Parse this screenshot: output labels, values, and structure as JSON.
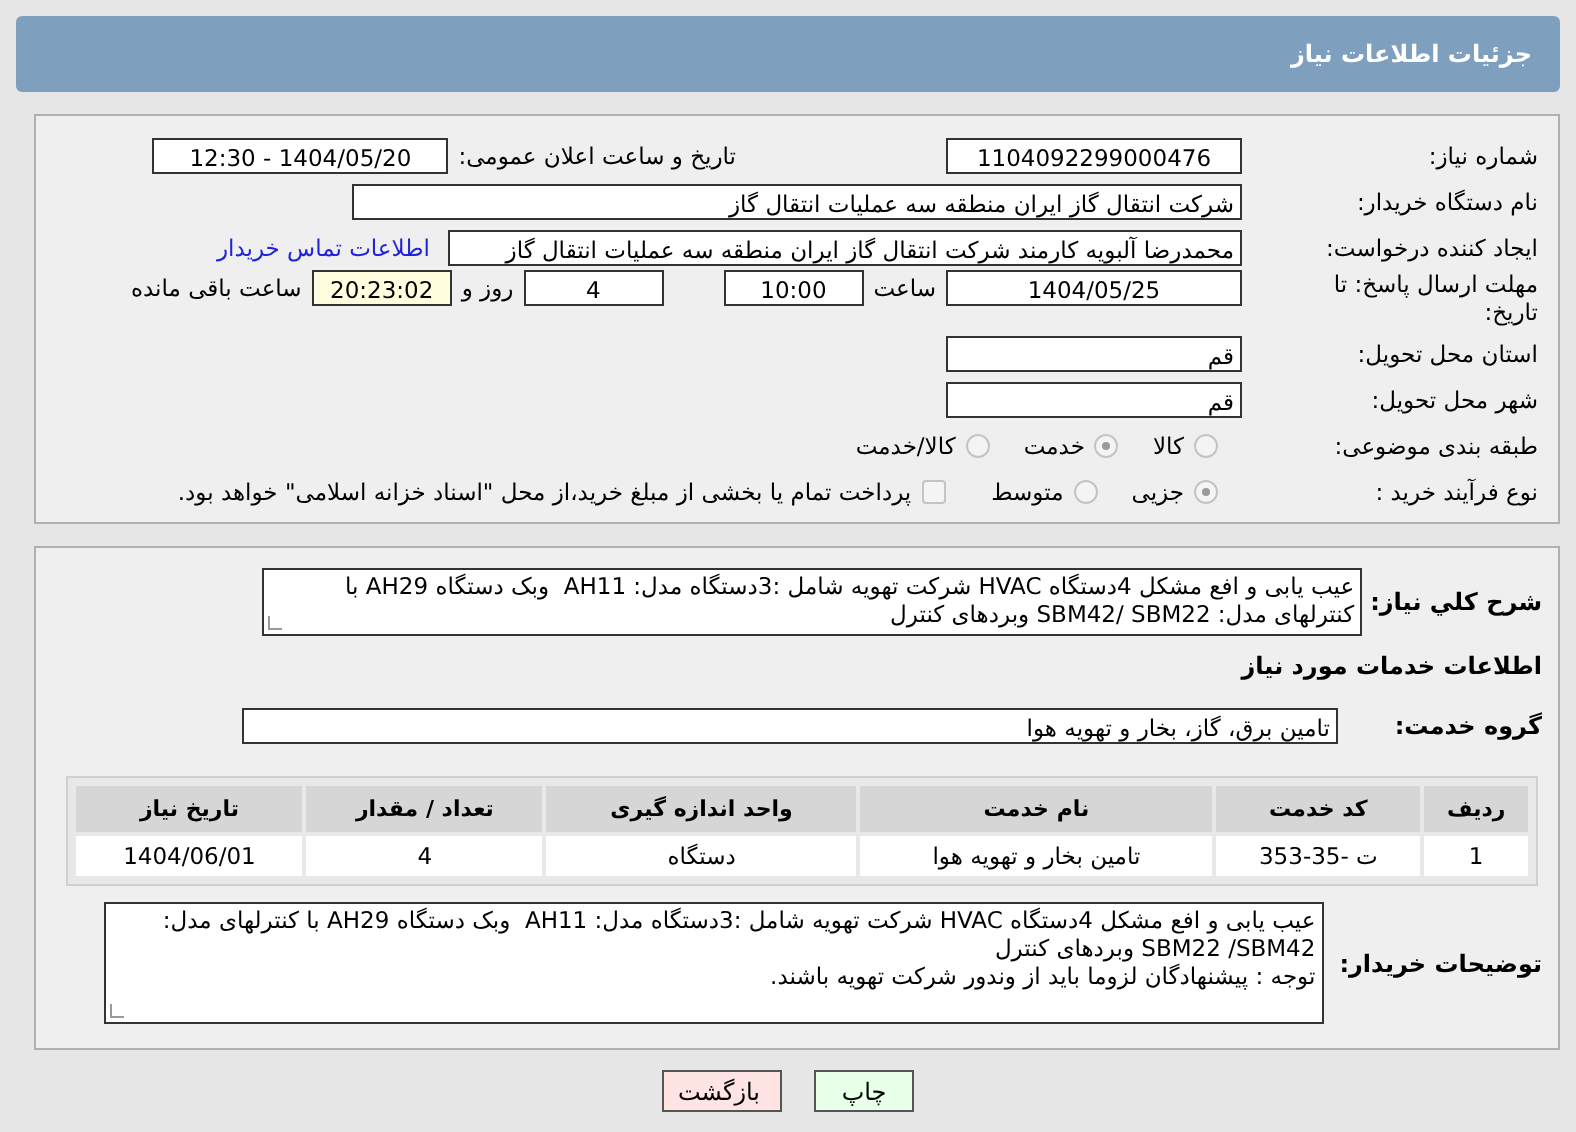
{
  "header": {
    "title": "جزئیات اطلاعات نیاز"
  },
  "need_number": {
    "label": "شماره نیاز:",
    "value": "1104092299000476"
  },
  "announce": {
    "label": "تاریخ و ساعت اعلان عمومی:",
    "value": "1404/05/20 - 12:30"
  },
  "buyer_org": {
    "label": "نام دستگاه خریدار:",
    "value": "شرکت انتقال گاز ایران منطقه سه عملیات انتقال گاز"
  },
  "requester": {
    "label": "ایجاد کننده درخواست:",
    "value": "محمدرضا آلبویه کارمند شرکت انتقال گاز ایران منطقه سه عملیات انتقال گاز",
    "link": "اطلاعات تماس خریدار"
  },
  "deadline": {
    "label": "مهلت ارسال پاسخ: تا تاریخ:",
    "date": "1404/05/25",
    "time_label": "ساعت",
    "time": "10:00",
    "days": "4",
    "days_label": "روز و",
    "remaining": "20:23:02",
    "remaining_label": "ساعت باقی مانده"
  },
  "province": {
    "label": "استان محل تحویل:",
    "value": "قم"
  },
  "city": {
    "label": "شهر محل تحویل:",
    "value": "قم"
  },
  "category": {
    "label": "طبقه بندی موضوعی:",
    "options": [
      {
        "label": "کالا",
        "selected": false
      },
      {
        "label": "خدمت",
        "selected": true
      },
      {
        "label": "کالا/خدمت",
        "selected": false
      }
    ]
  },
  "process": {
    "label": "نوع فرآیند خرید :",
    "options": [
      {
        "label": "جزیی",
        "selected": true
      },
      {
        "label": "متوسط",
        "selected": false
      }
    ],
    "payment": {
      "checked": false,
      "text": "پرداخت تمام یا بخشی از مبلغ خرید،از محل \"اسناد خزانه اسلامی\" خواهد بود."
    }
  },
  "summary": {
    "label": "شرح کلي نیاز:",
    "value": "عیب یابی و افع مشکل 4دستگاه HVAC شرکت تهویه شامل :3دستگاه مدل: AH11  وبک دستگاه AH29 با کنترلهای مدل: SBM42/ SBM22 وبردهای کنترل"
  },
  "services": {
    "title": "اطلاعات خدمات مورد نیاز",
    "group_label": "گروه خدمت:",
    "group": "تامین برق، گاز، بخار و تهویه هوا"
  },
  "table": {
    "columns": [
      "ردیف",
      "کد خدمت",
      "نام خدمت",
      "واحد اندازه گیری",
      "تعداد / مقدار",
      "تاریخ نیاز"
    ],
    "rows": [
      [
        "1",
        "ت -35-353",
        "تامین بخار و تهویه هوا",
        "دستگاه",
        "4",
        "1404/06/01"
      ]
    ]
  },
  "buyer_notes": {
    "label": "توضیحات خریدار:",
    "lines": [
      "عیب یابی و افع مشکل 4دستگاه HVAC شرکت تهویه شامل :3دستگاه مدل: AH11  وبک دستگاه AH29 با کنترلهای مدل: SBM22 /SBM42 وبردهای کنترل",
      "توجه : پیشنهادگان لزوما باید از وندور شرکت تهویه باشند."
    ]
  },
  "buttons": [
    {
      "label": "چاپ",
      "kind": "print"
    },
    {
      "label": "بازگشت",
      "kind": "back"
    }
  ]
}
